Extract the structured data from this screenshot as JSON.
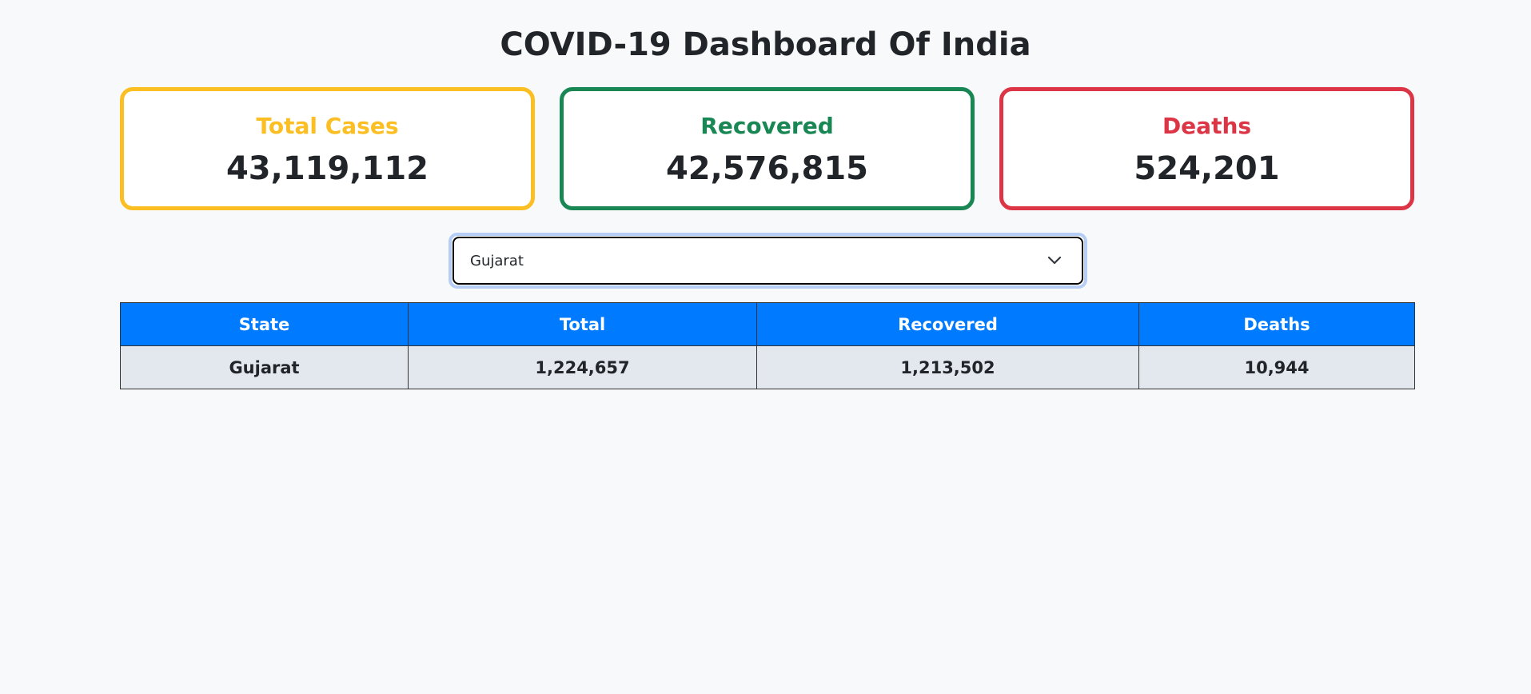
{
  "page": {
    "title": "COVID-19 Dashboard Of India"
  },
  "cards": [
    {
      "label": "Total Cases",
      "value": "43,119,112",
      "color": "#fbbf24"
    },
    {
      "label": "Recovered",
      "value": "42,576,815",
      "color": "#198754"
    },
    {
      "label": "Deaths",
      "value": "524,201",
      "color": "#dc3545"
    }
  ],
  "state_select": {
    "selected": "Gujarat",
    "icon": "chevron-down-icon"
  },
  "table": {
    "headers": [
      "State",
      "Total",
      "Recovered",
      "Deaths"
    ],
    "rows": [
      [
        "Gujarat",
        "1,224,657",
        "1,213,502",
        "10,944"
      ]
    ]
  },
  "colors": {
    "header_bg": "#007bff",
    "row_bg": "#e2e8ed",
    "page_bg": "#f8f9fa"
  }
}
